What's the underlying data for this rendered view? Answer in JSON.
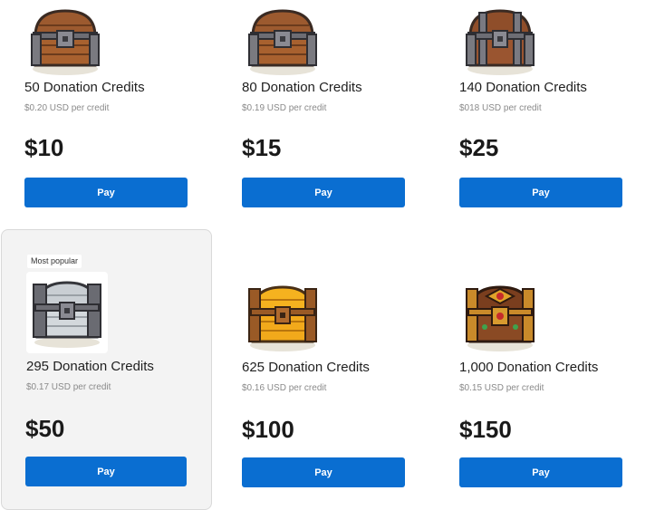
{
  "cards": [
    {
      "chest_icon": "brown-chest-icon",
      "title": "50 Donation Credits",
      "rate": "$0.20 USD per credit",
      "price": "$10",
      "button": "Pay"
    },
    {
      "chest_icon": "brown-chest-icon",
      "title": "80 Donation Credits",
      "rate": "$0.19 USD per credit",
      "price": "$15",
      "button": "Pay"
    },
    {
      "chest_icon": "brown-steel-chest-icon",
      "title": "140 Donation Credits",
      "rate": "$018 USD per credit",
      "price": "$25",
      "button": "Pay"
    },
    {
      "badge": "Most popular",
      "chest_icon": "silver-chest-icon",
      "title": "295 Donation Credits",
      "rate": "$0.17 USD per credit",
      "price": "$50",
      "button": "Pay"
    },
    {
      "chest_icon": "gold-chest-icon",
      "title": "625 Donation Credits",
      "rate": "$0.16 USD per credit",
      "price": "$100",
      "button": "Pay"
    },
    {
      "chest_icon": "jeweled-chest-icon",
      "title": "1,000 Donation Credits",
      "rate": "$0.15 USD per credit",
      "price": "$150",
      "button": "Pay"
    }
  ],
  "colors": {
    "pay_button": "#0a6ed1",
    "highlight_background": "#f3f3f3"
  }
}
